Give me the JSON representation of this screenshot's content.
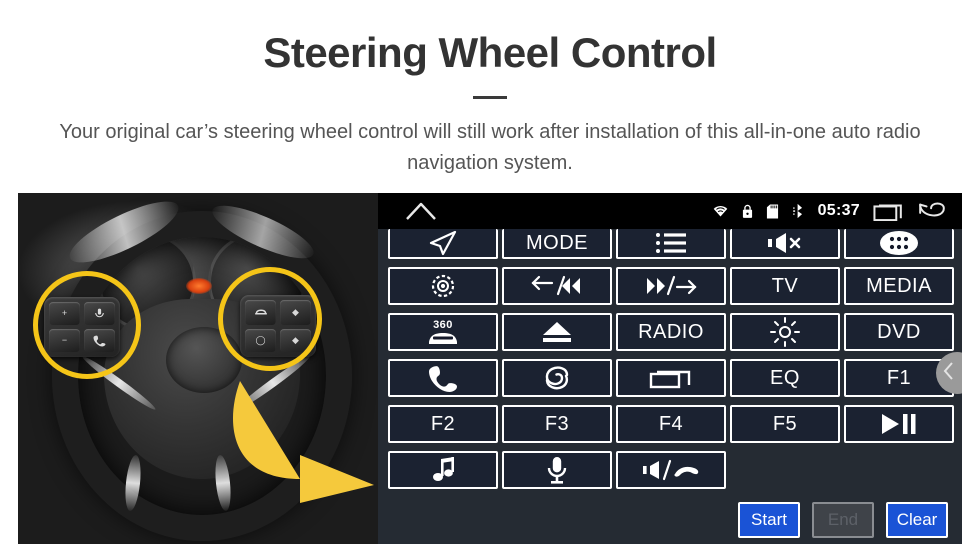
{
  "header": {
    "title": "Steering Wheel Control",
    "subtitle": "Your original car’s steering wheel control will still work after installation of this all-in-one auto radio navigation system."
  },
  "photo": {
    "alt": "car-steering-wheel-with-control-buttons",
    "highlight_color": "#F5C518",
    "arrow_color": "#F5C93C",
    "left_pod_keys": [
      "+",
      "mic-icon",
      "−",
      "call-icon"
    ],
    "right_pod_keys": [
      "cruise-icon",
      "up-icon",
      "circle-icon",
      "down-icon"
    ]
  },
  "radio": {
    "statusbar": {
      "home_icon": "home-icon",
      "icons": [
        "wifi-icon",
        "lock-icon",
        "sd-card-icon",
        "bluetooth-icon"
      ],
      "clock": "05:37",
      "recents_icon": "recents-icon",
      "back_icon": "back-icon"
    },
    "panel_bg": "#252b33",
    "button_bg": "#1b2231",
    "accent": "#1a53d6",
    "buttons": [
      {
        "name": "navigation",
        "icon": "navigation-arrow-icon",
        "label": "",
        "clipped": true
      },
      {
        "name": "mode",
        "icon": "",
        "label": "MODE",
        "clipped": true
      },
      {
        "name": "list",
        "icon": "list-icon",
        "label": "",
        "clipped": true
      },
      {
        "name": "mute",
        "icon": "mute-icon",
        "label": "",
        "clipped": true
      },
      {
        "name": "apps",
        "icon": "apps-grid-icon",
        "label": "",
        "clipped": true
      },
      {
        "name": "power-disc",
        "icon": "disc-icon",
        "label": "",
        "clipped": false
      },
      {
        "name": "previous",
        "icon": "previous-track-icon",
        "label": "",
        "clipped": false
      },
      {
        "name": "next",
        "icon": "next-track-icon",
        "label": "",
        "clipped": false
      },
      {
        "name": "tv",
        "icon": "",
        "label": "TV",
        "clipped": false
      },
      {
        "name": "media",
        "icon": "",
        "label": "MEDIA",
        "clipped": false
      },
      {
        "name": "camera-360",
        "icon": "car-360-icon",
        "label": "",
        "clipped": false
      },
      {
        "name": "eject",
        "icon": "eject-icon",
        "label": "",
        "clipped": false
      },
      {
        "name": "radio",
        "icon": "",
        "label": "RADIO",
        "clipped": false
      },
      {
        "name": "brightness",
        "icon": "brightness-icon",
        "label": "",
        "clipped": false
      },
      {
        "name": "dvd",
        "icon": "",
        "label": "DVD",
        "clipped": false
      },
      {
        "name": "phone",
        "icon": "phone-icon",
        "label": "",
        "clipped": false
      },
      {
        "name": "voice-assistant",
        "icon": "swirl-icon",
        "label": "",
        "clipped": false
      },
      {
        "name": "windows",
        "icon": "window-switch-icon",
        "label": "",
        "clipped": false
      },
      {
        "name": "eq",
        "icon": "",
        "label": "EQ",
        "clipped": false
      },
      {
        "name": "f1",
        "icon": "",
        "label": "F1",
        "clipped": false
      },
      {
        "name": "f2",
        "icon": "",
        "label": "F2",
        "clipped": false
      },
      {
        "name": "f3",
        "icon": "",
        "label": "F3",
        "clipped": false
      },
      {
        "name": "f4",
        "icon": "",
        "label": "F4",
        "clipped": false
      },
      {
        "name": "f5",
        "icon": "",
        "label": "F5",
        "clipped": false
      },
      {
        "name": "play-pause",
        "icon": "play-pause-icon",
        "label": "",
        "clipped": false
      },
      {
        "name": "music",
        "icon": "music-note-icon",
        "label": "",
        "clipped": false
      },
      {
        "name": "microphone",
        "icon": "microphone-icon",
        "label": "",
        "clipped": false
      },
      {
        "name": "volume-hangup",
        "icon": "volume-hangup-icon",
        "label": "",
        "clipped": false
      }
    ],
    "actions": [
      {
        "name": "start",
        "label": "Start",
        "state": "enabled"
      },
      {
        "name": "end",
        "label": "End",
        "state": "disabled"
      },
      {
        "name": "clear",
        "label": "Clear",
        "state": "enabled"
      }
    ],
    "side_tab_icon": "chevron-left-icon"
  }
}
